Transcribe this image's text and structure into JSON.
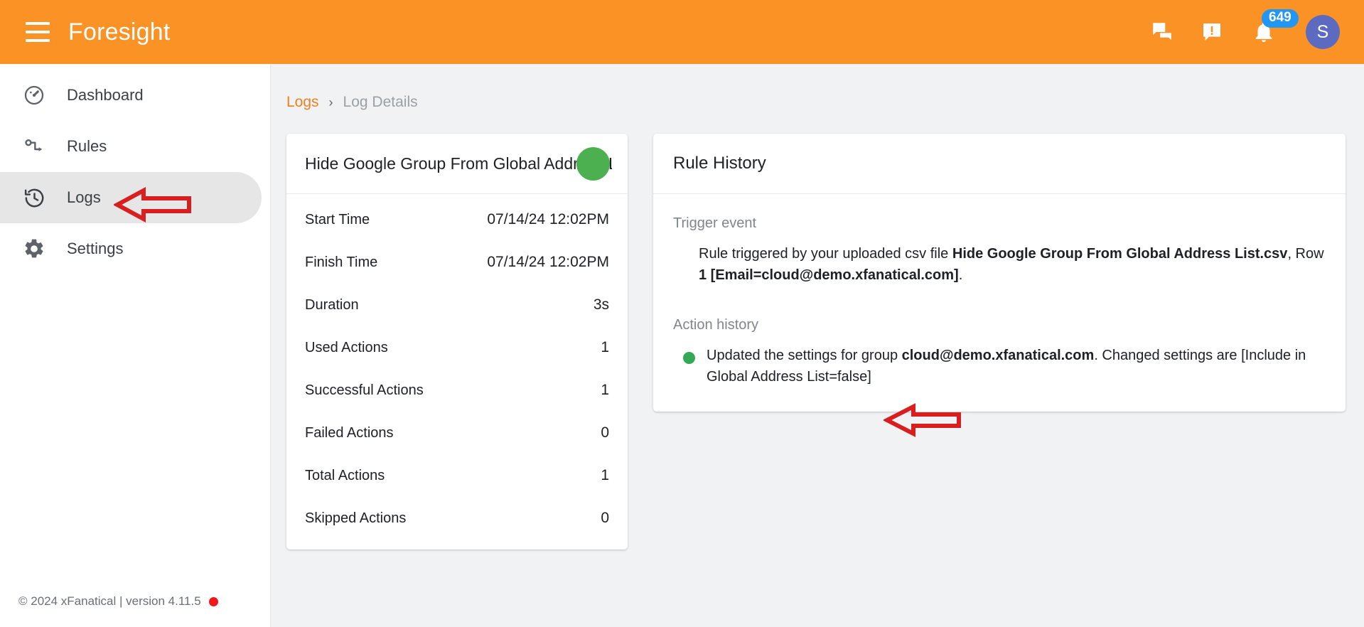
{
  "header": {
    "app_title": "Foresight",
    "menu_icon": "hamburger-menu-icon",
    "chat_icon": "chat-bubbles-icon",
    "feedback_icon": "announcement-icon",
    "bell_icon": "notifications-bell-icon",
    "notification_count": "649",
    "avatar_initial": "S",
    "brand_color": "#FA9226",
    "badge_color": "#2196F3",
    "avatar_color": "#5C6BC0"
  },
  "sidebar": {
    "items": [
      {
        "label": "Dashboard",
        "icon": "speedometer-icon",
        "active": false
      },
      {
        "label": "Rules",
        "icon": "rule-path-icon",
        "active": false
      },
      {
        "label": "Logs",
        "icon": "history-clock-icon",
        "active": true
      },
      {
        "label": "Settings",
        "icon": "gear-icon",
        "active": false
      }
    ],
    "footer": {
      "text": "© 2024 xFanatical | version 4.11.5",
      "status_dot_color": "#F01818"
    }
  },
  "breadcrumb": {
    "parent": "Logs",
    "separator": "›",
    "current": "Log Details"
  },
  "log_summary": {
    "rule_title": "Hide Google Group From Global Address List",
    "status_color": "#4CAF50",
    "rows": [
      {
        "label": "Start Time",
        "value": "07/14/24 12:02PM"
      },
      {
        "label": "Finish Time",
        "value": "07/14/24 12:02PM"
      },
      {
        "label": "Duration",
        "value": "3s"
      },
      {
        "label": "Used Actions",
        "value": "1"
      },
      {
        "label": "Successful Actions",
        "value": "1"
      },
      {
        "label": "Failed Actions",
        "value": "0"
      },
      {
        "label": "Total Actions",
        "value": "1"
      },
      {
        "label": "Skipped Actions",
        "value": "0"
      }
    ]
  },
  "rule_history": {
    "title": "Rule History",
    "trigger_event": {
      "label": "Trigger event",
      "prefix": "Rule triggered by your uploaded csv file ",
      "file_name": "Hide Google Group From Global Address List.csv",
      "middle": ", Row ",
      "row_detail": "1 [Email=cloud@demo.xfanatical.com]",
      "suffix": "."
    },
    "action_history": {
      "label": "Action history",
      "entries": [
        {
          "dot_color": "#34A853",
          "prefix": "Updated the settings for group ",
          "group": "cloud@demo.xfanatical.com",
          "suffix": ". Changed settings are [Include in Global Address List=false]"
        }
      ]
    }
  },
  "annotations": {
    "arrow_color": "#D81E1E",
    "arrow_sidebar_target": "Logs",
    "arrow_action_target": "Action history entry"
  }
}
